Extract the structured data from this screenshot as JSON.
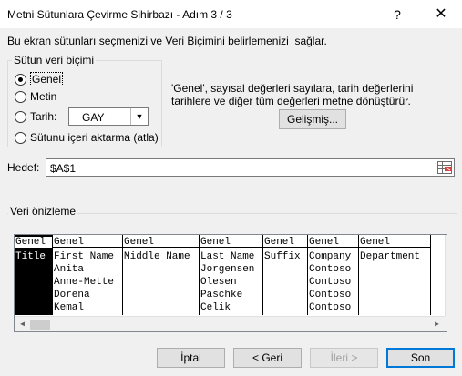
{
  "window": {
    "title": "Metni Sütunlara Çevirme Sihirbazı - Adım 3 / 3",
    "help_label": "?",
    "close_label": "✕"
  },
  "intro_text": "Bu ekran sütunları seçmenizi ve Veri Biçimini belirlemenizi  sağlar.",
  "column_format": {
    "group_title": "Sütun veri biçimi",
    "options": [
      {
        "label": "Genel",
        "checked": true
      },
      {
        "label": "Metin",
        "checked": false
      },
      {
        "label": "Tarih:",
        "checked": false
      },
      {
        "label": "Sütunu içeri aktarma (atla)",
        "checked": false
      }
    ],
    "date_format_value": "GAY"
  },
  "description": "'Genel', sayısal değerleri sayılara, tarih değerlerini tarihlere ve diğer tüm değerleri metne dönüştürür.",
  "advanced_button": "Gelişmiş...",
  "target": {
    "label": "Hedef:",
    "value": "$A$1",
    "picker_icon": "range-picker-icon"
  },
  "preview": {
    "group_title": "Veri önizleme",
    "columns": [
      {
        "header": "Genel",
        "cells": [
          "Title",
          "",
          "",
          "",
          ""
        ],
        "selected": true
      },
      {
        "header": "Genel",
        "cells": [
          "First Name",
          "Anita",
          "Anne-Mette",
          "Dorena",
          "Kemal"
        ]
      },
      {
        "header": "Genel",
        "cells": [
          "Middle Name",
          "",
          "",
          "",
          ""
        ]
      },
      {
        "header": "Genel",
        "cells": [
          "Last Name",
          "Jorgensen",
          "Olesen",
          "Paschke",
          "Celik"
        ]
      },
      {
        "header": "Genel",
        "cells": [
          "Suffix",
          "",
          "",
          "",
          ""
        ]
      },
      {
        "header": "Genel",
        "cells": [
          "Company",
          "Contoso",
          "Contoso",
          "Contoso",
          "Contoso"
        ]
      },
      {
        "header": "Genel",
        "cells": [
          "Department",
          "",
          "",
          "",
          ""
        ]
      }
    ]
  },
  "buttons": {
    "cancel": "İptal",
    "back": "< Geri",
    "next": "İleri >",
    "finish": "Son"
  }
}
